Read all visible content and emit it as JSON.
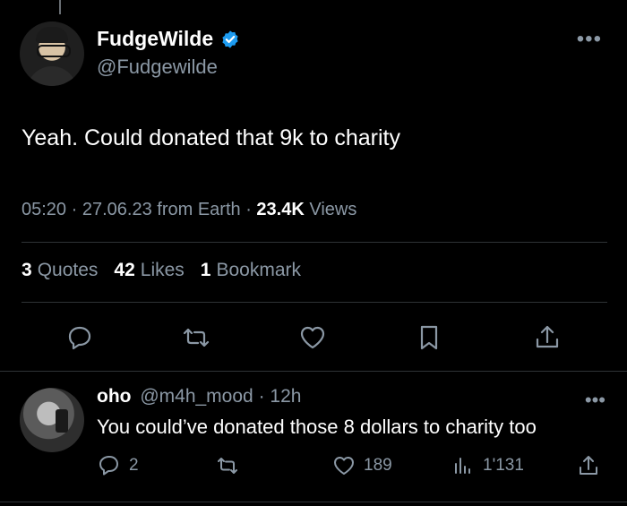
{
  "tweet": {
    "author": {
      "name": "FudgeWilde",
      "handle": "@Fudgewilde",
      "verified_icon": "verified-badge-icon",
      "avatar": "avatar"
    },
    "text": "Yeah. Could donated that 9k to charity",
    "time": "05:20",
    "date": "27.06.23",
    "source": "from Earth",
    "views_count": "23.4K",
    "views_label": "Views",
    "more_label": "•••"
  },
  "stats": {
    "quotes_count": "3",
    "quotes_label": "Quotes",
    "likes_count": "42",
    "likes_label": "Likes",
    "bookmarks_count": "1",
    "bookmarks_label": "Bookmark"
  },
  "actions": [
    "reply-icon",
    "retweet-icon",
    "like-icon",
    "bookmark-icon",
    "share-icon"
  ],
  "reply": {
    "name": "oho",
    "handle": "@m4h_mood",
    "time": "12h",
    "text": "You could’ve donated those 8 dollars to charity too",
    "reply_count": "2",
    "like_count": "189",
    "views_count": "1'131",
    "more_label": "•••"
  },
  "colors": {
    "background": "#000000",
    "text": "#e7e9ea",
    "muted": "#8b98a5",
    "verified": "#1d9bf0",
    "divider": "#2f3336"
  }
}
